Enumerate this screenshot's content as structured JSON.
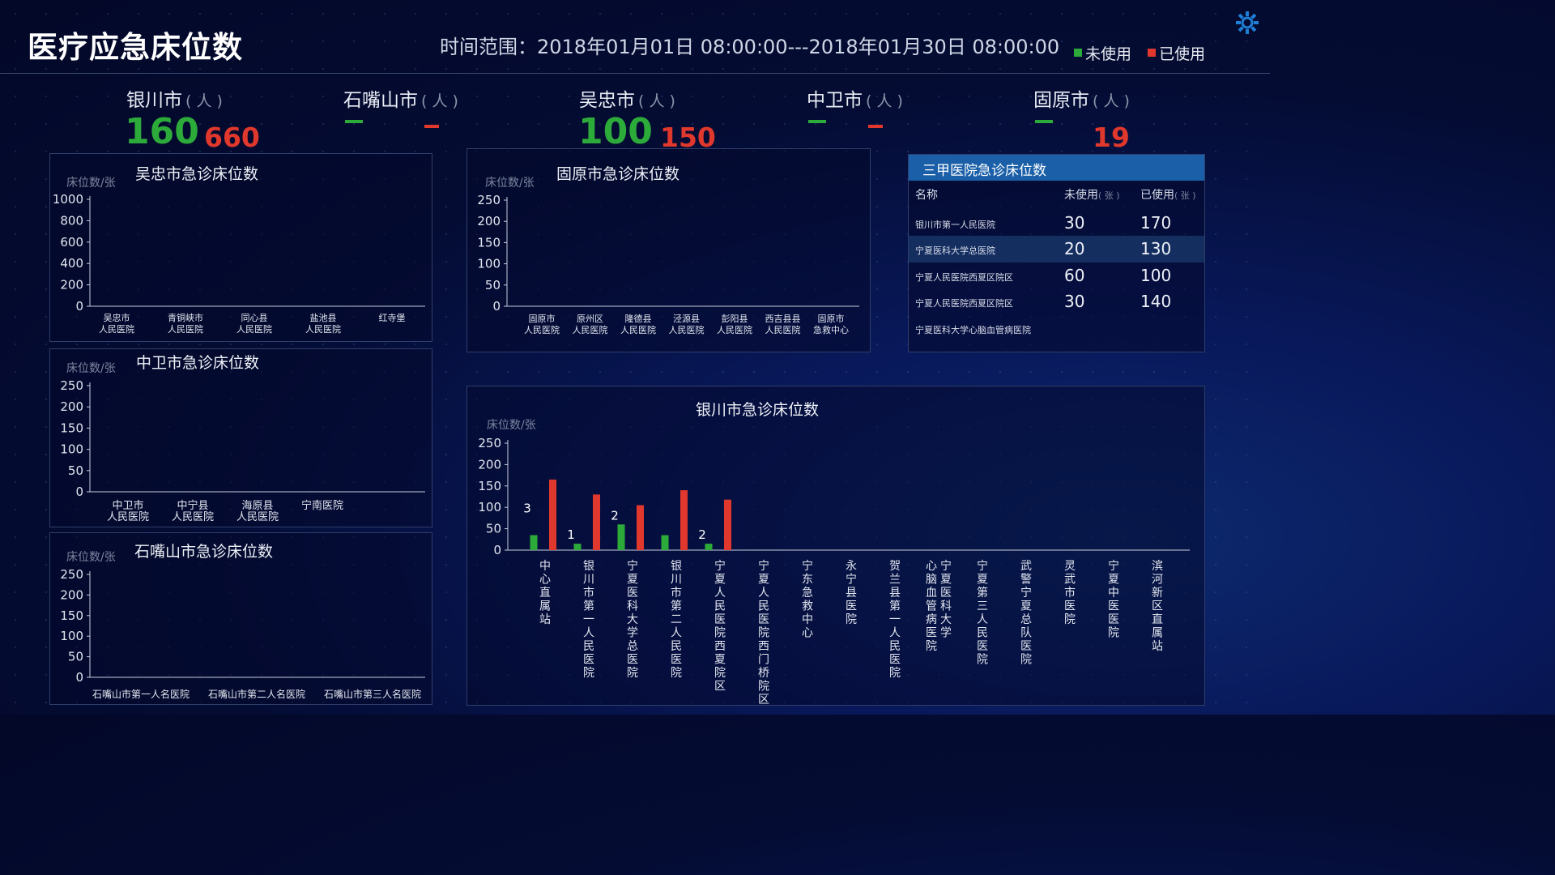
{
  "header": {
    "title": "医疗应急床位数",
    "time_range": "时间范围：2018年01月01日 08:00:00---2018年01月30日 08:00:00",
    "legend": [
      {
        "label": "未使用",
        "color": "#2dab3a"
      },
      {
        "label": "已使用",
        "color": "#e0382c"
      }
    ],
    "settings_icon": "gear-icon"
  },
  "cities": [
    {
      "name": "银川市",
      "unit": "( 人 )",
      "unused": "160",
      "used": "660"
    },
    {
      "name": "石嘴山市",
      "unit": "( 人 )",
      "unused": "",
      "used": ""
    },
    {
      "name": "吴忠市",
      "unit": "( 人 )",
      "unused": "100",
      "used": "150"
    },
    {
      "name": "中卫市",
      "unit": "( 人 )",
      "unused": "",
      "used": ""
    },
    {
      "name": "固原市",
      "unit": "( 人 )",
      "unused": "",
      "used": "19"
    }
  ],
  "top_hospitals": {
    "title": "三甲医院急诊床位数",
    "columns": {
      "name": "名称",
      "unused": "未使用",
      "used": "已使用",
      "unit": "( 张 )"
    },
    "rows": [
      {
        "name": "银川市第一人民医院",
        "unused": "30",
        "used": "170"
      },
      {
        "name": "宁夏医科大学总医院",
        "unused": "20",
        "used": "130"
      },
      {
        "name": "宁夏人民医院西夏区院区",
        "unused": "60",
        "used": "100"
      },
      {
        "name": "宁夏人民医院西夏区院区",
        "unused": "30",
        "used": "140"
      },
      {
        "name": "宁夏医科大学心脑血管病医院",
        "unused": "",
        "used": ""
      }
    ]
  },
  "chart_data": [
    {
      "id": "wuzhong",
      "type": "bar",
      "title": "吴忠市急诊床位数",
      "ylabel": "床位数/张",
      "ylim": [
        0,
        1000
      ],
      "yticks": [
        0,
        200,
        400,
        600,
        800,
        1000
      ],
      "categories": [
        [
          "吴忠市",
          "人民医院"
        ],
        [
          "青铜峡市",
          "人民医院"
        ],
        [
          "同心县",
          "人民医院"
        ],
        [
          "盐池县",
          "人民医院"
        ],
        [
          "红寺堡"
        ]
      ],
      "series": [
        {
          "name": "未使用",
          "color": "#2dab3a",
          "values": [
            0,
            0,
            0,
            0,
            0
          ]
        },
        {
          "name": "已使用",
          "color": "#e0382c",
          "values": [
            0,
            0,
            0,
            0,
            0
          ]
        }
      ]
    },
    {
      "id": "guyuan",
      "type": "bar",
      "title": "固原市急诊床位数",
      "ylabel": "床位数/张",
      "ylim": [
        0,
        250
      ],
      "yticks": [
        0,
        50,
        100,
        150,
        200,
        250
      ],
      "categories": [
        [
          "固原市",
          "人民医院"
        ],
        [
          "原州区",
          "人民医院"
        ],
        [
          "隆德县",
          "人民医院"
        ],
        [
          "泾源县",
          "人民医院"
        ],
        [
          "彭阳县",
          "人民医院"
        ],
        [
          "西吉县县",
          "人民医院"
        ],
        [
          "固原市",
          "急救中心"
        ]
      ],
      "series": [
        {
          "name": "未使用",
          "color": "#2dab3a",
          "values": [
            0,
            0,
            0,
            0,
            0,
            0,
            0
          ]
        },
        {
          "name": "已使用",
          "color": "#e0382c",
          "values": [
            0,
            0,
            0,
            0,
            0,
            0,
            0
          ]
        }
      ]
    },
    {
      "id": "zhongwei",
      "type": "bar",
      "title": "中卫市急诊床位数",
      "ylabel": "床位数/张",
      "ylim": [
        0,
        250
      ],
      "yticks": [
        0,
        50,
        100,
        150,
        200,
        250
      ],
      "categories": [
        [
          "中卫市",
          "人民医院"
        ],
        [
          "中宁县",
          "人民医院"
        ],
        [
          "海原县",
          "人民医院"
        ],
        [
          "宁南医院"
        ]
      ],
      "series": [
        {
          "name": "未使用",
          "color": "#2dab3a",
          "values": [
            0,
            0,
            0,
            0
          ]
        },
        {
          "name": "已使用",
          "color": "#e0382c",
          "values": [
            0,
            0,
            0,
            0
          ]
        }
      ]
    },
    {
      "id": "shizuishan",
      "type": "bar",
      "title": "石嘴山市急诊床位数",
      "ylabel": "床位数/张",
      "ylim": [
        0,
        250
      ],
      "yticks": [
        0,
        50,
        100,
        150,
        200,
        250
      ],
      "categories": [
        [
          "石嘴山市第一人名医院"
        ],
        [
          "石嘴山市第二人名医院"
        ],
        [
          "石嘴山市第三人名医院"
        ]
      ],
      "series": [
        {
          "name": "未使用",
          "color": "#2dab3a",
          "values": [
            0,
            0,
            0
          ]
        },
        {
          "name": "已使用",
          "color": "#e0382c",
          "values": [
            0,
            0,
            0
          ]
        }
      ]
    },
    {
      "id": "yinchuan",
      "type": "bar",
      "title": "银川市急诊床位数",
      "ylabel": "床位数/张",
      "ylim": [
        0,
        250
      ],
      "yticks": [
        0,
        50,
        100,
        150,
        200,
        250
      ],
      "categories": [
        "中心直属站",
        "银川市第一人民医院",
        "宁夏医科大学总医院",
        "银川市第二人民医院",
        "宁夏人民医院西夏院区",
        "宁夏人民医院西门桥院区",
        "宁东急救中心",
        "永宁县医院",
        "贺兰县第一人民医院",
        "心脑血管病医院|宁夏医科大学",
        "宁夏第三人民医院",
        "武警宁夏总队医院",
        "灵武市医院",
        "宁夏中医医院",
        "滨河新区直属站"
      ],
      "series": [
        {
          "name": "未使用",
          "color": "#2dab3a",
          "values": [
            35,
            15,
            60,
            35,
            15,
            0,
            0,
            0,
            0,
            0,
            0,
            0,
            0,
            0,
            0
          ]
        },
        {
          "name": "已使用",
          "color": "#e0382c",
          "values": [
            165,
            130,
            105,
            140,
            118,
            0,
            0,
            0,
            0,
            0,
            0,
            0,
            0,
            0,
            0
          ]
        }
      ],
      "data_labels": [
        "3",
        "1",
        "2",
        "",
        "2",
        "",
        "",
        "",
        "",
        "",
        "",
        "",
        "",
        "",
        ""
      ]
    }
  ]
}
